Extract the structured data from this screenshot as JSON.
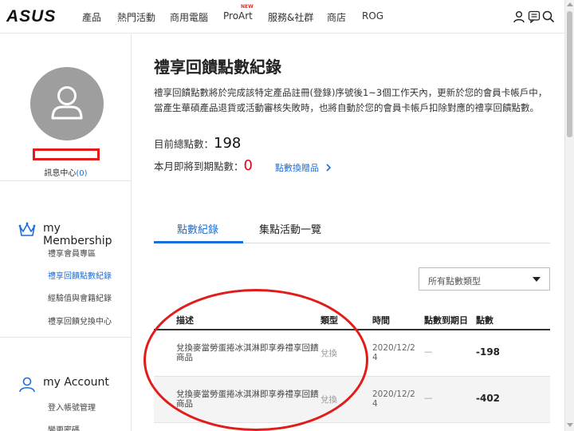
{
  "brand": {
    "logo": "ASUS"
  },
  "nav": {
    "items": [
      "產品",
      "熱門活動",
      "商用電腦",
      "ProArt",
      "服務&社群",
      "商店",
      "ROG"
    ],
    "proart_badge": "NEW"
  },
  "sidebar": {
    "message_center": "訊息中心",
    "message_count": "(0)",
    "membership": {
      "title": "my Membership",
      "links": [
        "禮享會員專區",
        "禮享回饋點數紀錄",
        "經驗值與會籍紀錄",
        "禮享回饋兌換中心"
      ]
    },
    "account": {
      "title": "my Account",
      "links": [
        "登入帳號管理",
        "變更密碼"
      ]
    }
  },
  "main": {
    "title": "禮享回饋點數紀錄",
    "description": "禮享回饋點數將於完成該特定產品註冊(登錄)序號後1~3個工作天內，更新於您的會員卡帳戶中，當產生華碩產品退貨或活動審核失敗時，也將自動於您的會員卡帳戶扣除對應的禮享回饋點數。",
    "total_label": "目前總點數：",
    "total_value": "198",
    "expire_label": "本月即將到期點數：",
    "expire_value": "0",
    "redeem_link": "點數換贈品"
  },
  "tabs": [
    "點數紀錄",
    "集點活動一覽"
  ],
  "filter": {
    "selected": "所有點數類型"
  },
  "table": {
    "headers": [
      "描述",
      "類型",
      "時間",
      "點數到期日",
      "點數"
    ],
    "rows": [
      {
        "desc": "兌換麥當勞蛋捲冰淇淋即享券禮享回饋商品",
        "type": "兌換",
        "date": "2020/12/24",
        "expiry": "—",
        "points": "-198"
      },
      {
        "desc": "兌換麥當勞蛋捲冰淇淋即享券禮享回饋商品",
        "type": "兌換",
        "date": "2020/12/24",
        "expiry": "—",
        "points": "-402"
      }
    ]
  },
  "colors": {
    "accent": "#1a6ed8",
    "alert": "#e3021b",
    "annotation": "#e21b1b"
  }
}
